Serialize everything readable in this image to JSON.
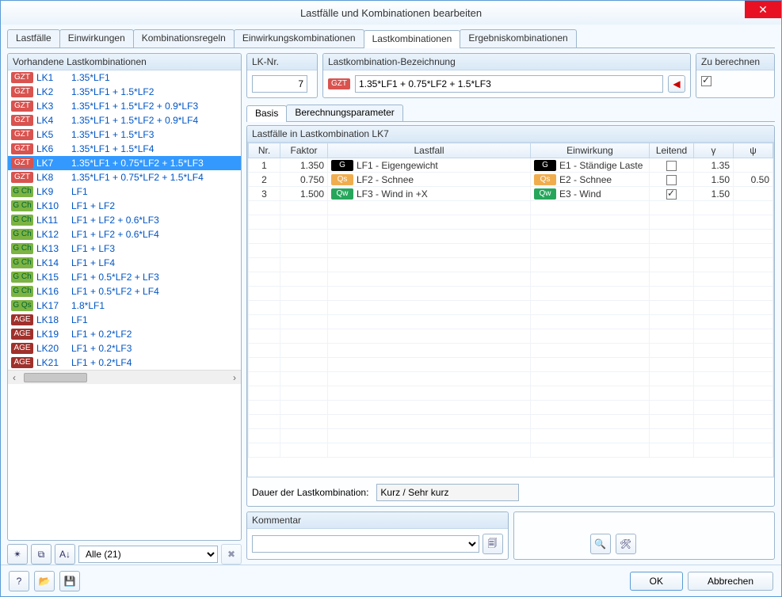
{
  "window": {
    "title": "Lastfälle und Kombinationen bearbeiten"
  },
  "main_tabs": [
    {
      "label": "Lastfälle"
    },
    {
      "label": "Einwirkungen"
    },
    {
      "label": "Kombinationsregeln"
    },
    {
      "label": "Einwirkungskombinationen"
    },
    {
      "label": "Lastkombinationen",
      "active": true
    },
    {
      "label": "Ergebniskombinationen"
    }
  ],
  "left": {
    "title": "Vorhandene Lastkombinationen",
    "items": [
      {
        "badge": "GZT",
        "id": "LK1",
        "formula": "1.35*LF1"
      },
      {
        "badge": "GZT",
        "id": "LK2",
        "formula": "1.35*LF1 + 1.5*LF2"
      },
      {
        "badge": "GZT",
        "id": "LK3",
        "formula": "1.35*LF1 + 1.5*LF2 + 0.9*LF3"
      },
      {
        "badge": "GZT",
        "id": "LK4",
        "formula": "1.35*LF1 + 1.5*LF2 + 0.9*LF4"
      },
      {
        "badge": "GZT",
        "id": "LK5",
        "formula": "1.35*LF1 + 1.5*LF3"
      },
      {
        "badge": "GZT",
        "id": "LK6",
        "formula": "1.35*LF1 + 1.5*LF4"
      },
      {
        "badge": "GZT",
        "id": "LK7",
        "formula": "1.35*LF1 + 0.75*LF2 + 1.5*LF3",
        "selected": true
      },
      {
        "badge": "GZT",
        "id": "LK8",
        "formula": "1.35*LF1 + 0.75*LF2 + 1.5*LF4"
      },
      {
        "badge": "GCh",
        "id": "LK9",
        "formula": "LF1"
      },
      {
        "badge": "GCh",
        "id": "LK10",
        "formula": "LF1 + LF2"
      },
      {
        "badge": "GCh",
        "id": "LK11",
        "formula": "LF1 + LF2 + 0.6*LF3"
      },
      {
        "badge": "GCh",
        "id": "LK12",
        "formula": "LF1 + LF2 + 0.6*LF4"
      },
      {
        "badge": "GCh",
        "id": "LK13",
        "formula": "LF1 + LF3"
      },
      {
        "badge": "GCh",
        "id": "LK14",
        "formula": "LF1 + LF4"
      },
      {
        "badge": "GCh",
        "id": "LK15",
        "formula": "LF1 + 0.5*LF2 + LF3"
      },
      {
        "badge": "GCh",
        "id": "LK16",
        "formula": "LF1 + 0.5*LF2 + LF4"
      },
      {
        "badge": "GQs",
        "id": "LK17",
        "formula": "1.8*LF1"
      },
      {
        "badge": "AGE",
        "id": "LK18",
        "formula": "LF1"
      },
      {
        "badge": "AGE",
        "id": "LK19",
        "formula": "LF1 + 0.2*LF2"
      },
      {
        "badge": "AGE",
        "id": "LK20",
        "formula": "LF1 + 0.2*LF3"
      },
      {
        "badge": "AGE",
        "id": "LK21",
        "formula": "LF1 + 0.2*LF4"
      }
    ],
    "filter_label": "Alle (21)"
  },
  "right": {
    "lknr_label": "LK-Nr.",
    "lknr_value": "7",
    "bez_label": "Lastkombination-Bezeichnung",
    "bez_badge": "GZT",
    "bez_value": "1.35*LF1 + 0.75*LF2 + 1.5*LF3",
    "calc_label": "Zu berechnen",
    "calc_checked": true,
    "subtabs": [
      {
        "label": "Basis",
        "active": true
      },
      {
        "label": "Berechnungsparameter"
      }
    ],
    "lf_group_title": "Lastfälle in Lastkombination LK7",
    "columns": {
      "nr": "Nr.",
      "faktor": "Faktor",
      "lastfall": "Lastfall",
      "einwirkung": "Einwirkung",
      "leitend": "Leitend",
      "gamma": "γ",
      "psi": "ψ"
    },
    "rows": [
      {
        "nr": "1",
        "faktor": "1.350",
        "lf_badge": "G",
        "lf": "LF1 - Eigengewicht",
        "ew_badge": "G",
        "ew": "E1 - Ständige Laste",
        "leitend": false,
        "gamma": "1.35",
        "psi": ""
      },
      {
        "nr": "2",
        "faktor": "0.750",
        "lf_badge": "Qs",
        "lf": "LF2 - Schnee",
        "ew_badge": "Qs",
        "ew": "E2 - Schnee",
        "leitend": false,
        "gamma": "1.50",
        "psi": "0.50"
      },
      {
        "nr": "3",
        "faktor": "1.500",
        "lf_badge": "Qw",
        "lf": "LF3 - Wind in +X",
        "ew_badge": "Qw",
        "ew": "E3 - Wind",
        "leitend": true,
        "gamma": "1.50",
        "psi": ""
      }
    ],
    "dauer_label": "Dauer der Lastkombination:",
    "dauer_value": "Kurz / Sehr kurz",
    "kommentar_label": "Kommentar"
  },
  "footer": {
    "ok": "OK",
    "cancel": "Abbrechen"
  }
}
